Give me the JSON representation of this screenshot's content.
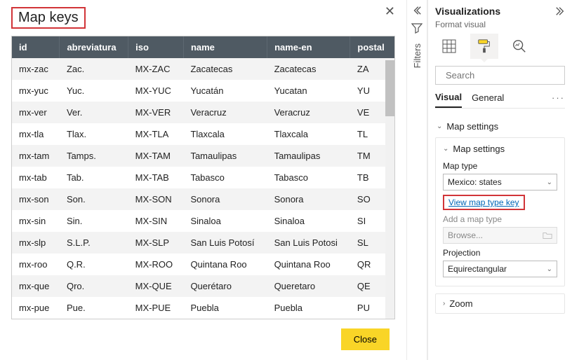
{
  "modal": {
    "title": "Map keys",
    "close_label": "Close",
    "columns": [
      "id",
      "abreviatura",
      "iso",
      "name",
      "name-en",
      "postal"
    ],
    "rows": [
      {
        "id": "mx-zac",
        "abreviatura": "Zac.",
        "iso": "MX-ZAC",
        "name": "Zacatecas",
        "name_en": "Zacatecas",
        "postal": "ZA"
      },
      {
        "id": "mx-yuc",
        "abreviatura": "Yuc.",
        "iso": "MX-YUC",
        "name": "Yucatán",
        "name_en": "Yucatan",
        "postal": "YU"
      },
      {
        "id": "mx-ver",
        "abreviatura": "Ver.",
        "iso": "MX-VER",
        "name": "Veracruz",
        "name_en": "Veracruz",
        "postal": "VE"
      },
      {
        "id": "mx-tla",
        "abreviatura": "Tlax.",
        "iso": "MX-TLA",
        "name": "Tlaxcala",
        "name_en": "Tlaxcala",
        "postal": "TL"
      },
      {
        "id": "mx-tam",
        "abreviatura": "Tamps.",
        "iso": "MX-TAM",
        "name": "Tamaulipas",
        "name_en": "Tamaulipas",
        "postal": "TM"
      },
      {
        "id": "mx-tab",
        "abreviatura": "Tab.",
        "iso": "MX-TAB",
        "name": "Tabasco",
        "name_en": "Tabasco",
        "postal": "TB"
      },
      {
        "id": "mx-son",
        "abreviatura": "Son.",
        "iso": "MX-SON",
        "name": "Sonora",
        "name_en": "Sonora",
        "postal": "SO"
      },
      {
        "id": "mx-sin",
        "abreviatura": "Sin.",
        "iso": "MX-SIN",
        "name": "Sinaloa",
        "name_en": "Sinaloa",
        "postal": "SI"
      },
      {
        "id": "mx-slp",
        "abreviatura": "S.L.P.",
        "iso": "MX-SLP",
        "name": "San Luis Potosí",
        "name_en": "San Luis Potosi",
        "postal": "SL"
      },
      {
        "id": "mx-roo",
        "abreviatura": "Q.R.",
        "iso": "MX-ROO",
        "name": "Quintana Roo",
        "name_en": "Quintana Roo",
        "postal": "QR"
      },
      {
        "id": "mx-que",
        "abreviatura": "Qro.",
        "iso": "MX-QUE",
        "name": "Querétaro",
        "name_en": "Queretaro",
        "postal": "QE"
      },
      {
        "id": "mx-pue",
        "abreviatura": "Pue.",
        "iso": "MX-PUE",
        "name": "Puebla",
        "name_en": "Puebla",
        "postal": "PU"
      }
    ]
  },
  "filters_rail": {
    "label": "Filters"
  },
  "viz": {
    "title": "Visualizations",
    "subtitle": "Format visual",
    "search_placeholder": "Search",
    "tabs": {
      "visual": "Visual",
      "general": "General"
    },
    "main_section": "Map settings",
    "map_settings": {
      "title": "Map settings",
      "map_type_label": "Map type",
      "map_type_value": "Mexico: states",
      "view_key": "View map type key",
      "add_label": "Add a map type",
      "browse_placeholder": "Browse...",
      "projection_label": "Projection",
      "projection_value": "Equirectangular"
    },
    "zoom_section": "Zoom"
  }
}
